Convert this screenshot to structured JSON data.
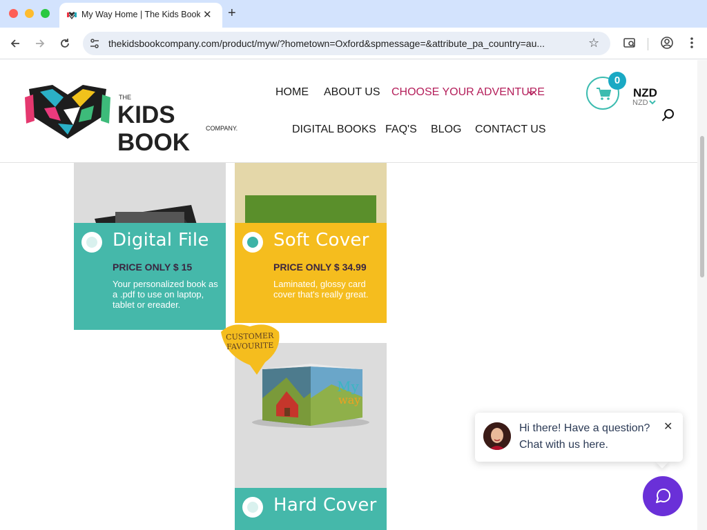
{
  "browser": {
    "tab_title": "My Way Home | The Kids Book Company",
    "new_tab_icon": "plus-icon",
    "url": "thekidsbookcompany.com/product/myw/?hometown=Oxford&spmessage=&attribute_pa_country=au..."
  },
  "header": {
    "logo_the": "THE",
    "logo_main": "KIDS BOOK",
    "logo_company": "COMPANY.",
    "nav": {
      "home": "HOME",
      "about": "ABOUT US",
      "choose": "CHOOSE YOUR ADVENTURE",
      "digital_books": "DIGITAL BOOKS",
      "faqs": "FAQ'S",
      "blog": "BLOG",
      "contact": "CONTACT US"
    },
    "cart_count": "0",
    "currency": "NZD",
    "currency_sub": "NZD",
    "accent_color": "#b41e5a"
  },
  "products": {
    "digital": {
      "title": "Digital File",
      "price": "PRICE ONLY $ 15",
      "desc": "Your personalized book as a .pdf to use on laptop, tablet or ereader.",
      "color": "#45b8aa"
    },
    "soft": {
      "title": "Soft Cover",
      "price": "PRICE ONLY $ 34.99",
      "desc": "Laminated, glossy card cover that's really great.",
      "color": "#f5bd1e",
      "selected": true
    },
    "badge": "CUSTOMER FAVOURITE",
    "hard": {
      "title": "Hard Cover",
      "color": "#45b8aa",
      "book_title_art": "My Way"
    }
  },
  "chat": {
    "line1": "Hi there! Have a question?",
    "line2": "Chat with us here.",
    "launcher_color": "#6a30d8"
  }
}
